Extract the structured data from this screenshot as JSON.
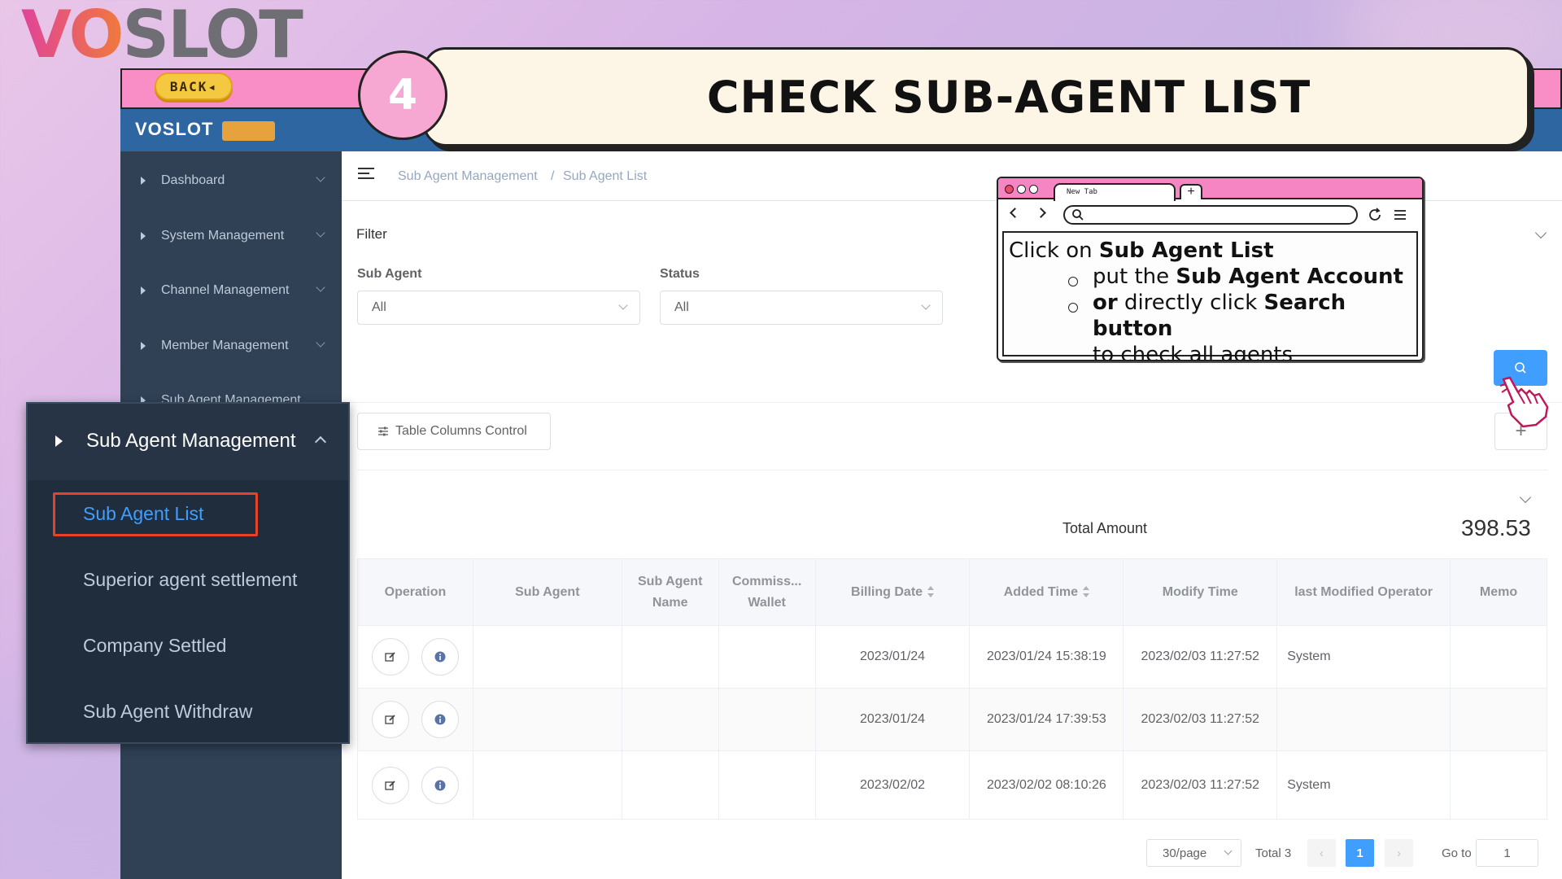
{
  "brand_logo": "VOSLOT",
  "back_button": "BACK◂",
  "header": {
    "brand": "VOSLOT"
  },
  "step": {
    "number": "4",
    "title": "CHECK SUB-AGENT LIST"
  },
  "sidebar": {
    "items": [
      {
        "label": "Dashboard"
      },
      {
        "label": "System Management"
      },
      {
        "label": "Channel Management"
      },
      {
        "label": "Member Management"
      },
      {
        "label": "Sub Agent Management"
      }
    ]
  },
  "submenu": {
    "title": "Sub Agent Management",
    "items": [
      "Sub Agent List",
      "Superior agent settlement",
      "Company Settled",
      "Sub Agent Withdraw"
    ]
  },
  "breadcrumb": [
    "Sub Agent Management",
    "/",
    "Sub Agent List"
  ],
  "filter": {
    "title": "Filter",
    "sub_agent_label": "Sub Agent",
    "sub_agent_value": "All",
    "status_label": "Status",
    "status_value": "All"
  },
  "toolbar": {
    "table_columns_control": "Table Columns Control",
    "add_icon": "plus-icon",
    "search_icon": "search-icon"
  },
  "summary": {
    "total_label": "Total Amount",
    "total_value": "398.53"
  },
  "table": {
    "headers": {
      "operation": "Operation",
      "sub_agent": "Sub Agent",
      "sub_agent_name_1": "Sub Agent",
      "sub_agent_name_2": "Name",
      "commission_1": "Commiss...",
      "commission_2": "Wallet",
      "billing_date": "Billing Date",
      "added_time": "Added Time",
      "modify_time": "Modify Time",
      "last_operator": "last Modified Operator",
      "memo": "Memo"
    },
    "rows": [
      {
        "billing_date": "2023/01/24",
        "added_time": "2023/01/24 15:38:19",
        "modify_time": "2023/02/03 11:27:52",
        "operator": "System"
      },
      {
        "billing_date": "2023/01/24",
        "added_time": "2023/01/24 17:39:53",
        "modify_time": "2023/02/03 11:27:52",
        "operator": ""
      },
      {
        "billing_date": "2023/02/02",
        "added_time": "2023/02/02 08:10:26",
        "modify_time": "2023/02/03 11:27:52",
        "operator": "System"
      }
    ]
  },
  "pagination": {
    "page_size": "30/page",
    "total": "Total 3",
    "current_page": "1",
    "goto_label": "Go to",
    "goto_value": "1"
  },
  "callout": {
    "tab_label": "New Tab",
    "line1_pre": "Click on ",
    "line1_bold": "Sub Agent List",
    "line2_pre": "put the ",
    "line2_bold": "Sub Agent Account",
    "line3_bold1": "or",
    "line3_mid": " directly  click  ",
    "line3_bold2": "Search  button",
    "line4": "to check all agents"
  },
  "colors": {
    "accent": "#409eff",
    "sidebar": "#304156",
    "header": "#2d66a0",
    "pink": "#f98dc6",
    "highlight": "#e8412a"
  }
}
